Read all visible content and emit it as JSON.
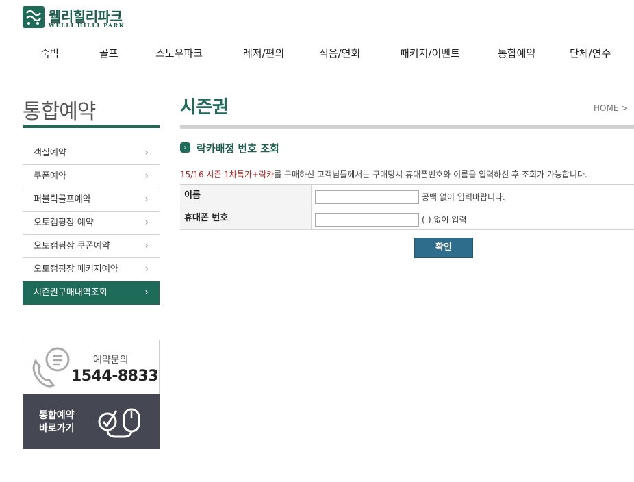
{
  "header": {
    "logo_kr": "웰리힐리파크",
    "logo_en": "WELLI HILLI PARK",
    "nav": [
      "숙박",
      "골프",
      "스노우파크",
      "레저/편의",
      "식음/연회",
      "패키지/이벤트",
      "통합예약",
      "단체/연수"
    ]
  },
  "sidebar": {
    "title": "통합예약",
    "items": [
      {
        "label": "객실예약",
        "active": false
      },
      {
        "label": "쿠폰예약",
        "active": false
      },
      {
        "label": "퍼블릭골프예약",
        "active": false
      },
      {
        "label": "오토캠핑장 예약",
        "active": false
      },
      {
        "label": "오토캠핑장 쿠폰예약",
        "active": false
      },
      {
        "label": "오토캠핑장 패키지예약",
        "active": false
      },
      {
        "label": "시즌권구매내역조회",
        "active": true
      }
    ],
    "chevron": "›",
    "contact": {
      "label": "예약문의",
      "phone": "1544-8833",
      "icon": "phone-chat-icon"
    },
    "shortcut": {
      "line1": "통합예약",
      "line2": "바로가기",
      "icon": "check-mouse-icon"
    }
  },
  "main": {
    "title": "시즌권",
    "breadcrumb": "HOME  >",
    "section_title": "락카배정 번호 조회",
    "notice_highlight": "15/16 시즌 1차특가+락카",
    "notice_rest": "를 구매하신 고객님들께서는 구매당시 휴대폰번호와 이름을 입력하신 후 조회가 가능합니다.",
    "form": {
      "name_label": "이름",
      "name_value": "",
      "name_hint": "공백 없이 입력바랍니다.",
      "phone_label": "휴대폰 번호",
      "phone_value": "",
      "phone_hint": "(-) 없이 입력"
    },
    "confirm_label": "확인"
  },
  "colors": {
    "brand_green": "#1f6b5a",
    "button_blue": "#2e6d8c",
    "notice_red": "#b62323",
    "dark_panel": "#454852"
  }
}
